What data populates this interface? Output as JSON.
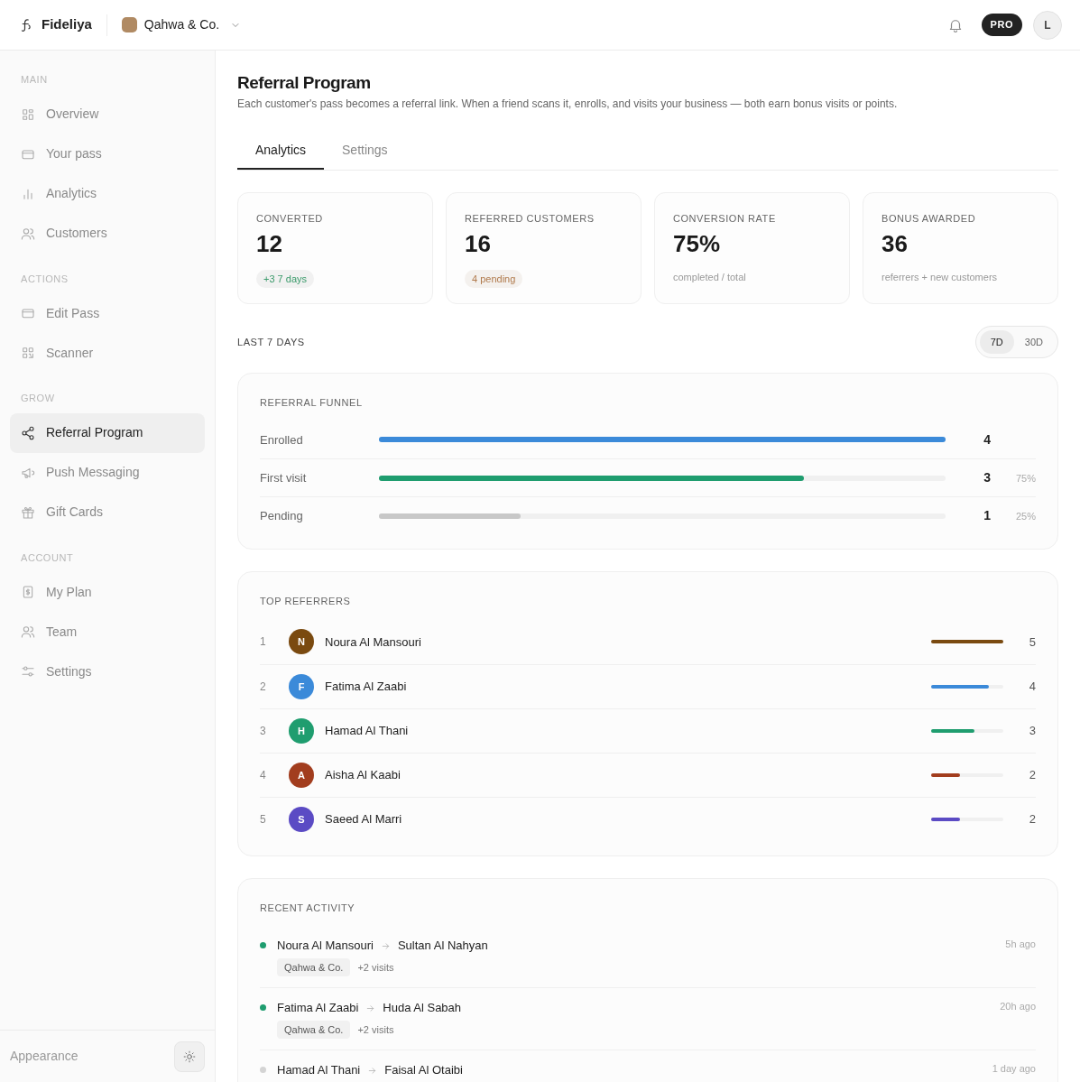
{
  "header": {
    "brand": "Fideliya",
    "business": "Qahwa & Co.",
    "plan_badge": "PRO",
    "avatar_initial": "L"
  },
  "sidebar": {
    "sections": [
      {
        "title": "MAIN",
        "items": [
          {
            "label": "Overview",
            "selected": false
          },
          {
            "label": "Your pass",
            "selected": false
          },
          {
            "label": "Analytics",
            "selected": false
          },
          {
            "label": "Customers",
            "selected": false
          }
        ]
      },
      {
        "title": "ACTIONS",
        "items": [
          {
            "label": "Edit Pass",
            "selected": false
          },
          {
            "label": "Scanner",
            "selected": false
          }
        ]
      },
      {
        "title": "GROW",
        "items": [
          {
            "label": "Referral Program",
            "selected": true
          },
          {
            "label": "Push Messaging",
            "selected": false
          },
          {
            "label": "Gift Cards",
            "selected": false
          }
        ]
      },
      {
        "title": "ACCOUNT",
        "items": [
          {
            "label": "My Plan",
            "selected": false
          },
          {
            "label": "Team",
            "selected": false
          },
          {
            "label": "Settings",
            "selected": false
          }
        ]
      }
    ],
    "footer_label": "Appearance"
  },
  "page": {
    "title": "Referral Program",
    "subtitle": "Each customer's pass becomes a referral link. When a friend scans it, enrolls, and visits your business — both earn bonus visits or points.",
    "tabs": [
      {
        "label": "Analytics",
        "selected": true
      },
      {
        "label": "Settings",
        "selected": false
      }
    ],
    "stats": [
      {
        "label": "CONVERTED",
        "value": "12",
        "note": "+3 7 days",
        "kind": "positive"
      },
      {
        "label": "REFERRED CUSTOMERS",
        "value": "16",
        "note": "4 pending",
        "kind": "warning"
      },
      {
        "label": "CONVERSION RATE",
        "value": "75%",
        "note": "completed / total",
        "kind": "plain"
      },
      {
        "label": "BONUS AWARDED",
        "value": "36",
        "note": "referrers + new customers",
        "kind": "plain"
      }
    ],
    "period_label": "LAST 7 DAYS",
    "periods": [
      {
        "label": "7D",
        "selected": true
      },
      {
        "label": "30D",
        "selected": false
      }
    ],
    "funnel": {
      "title": "REFERRAL FUNNEL",
      "rows": [
        {
          "label": "Enrolled",
          "count": "4",
          "level": 1,
          "color": "#3b8ad9"
        },
        {
          "label": "First visit",
          "count": "3",
          "percent": "75%",
          "level": 0.75,
          "color": "#1f9d6f"
        },
        {
          "label": "Pending",
          "count": "1",
          "percent": "25%",
          "level": 0.25,
          "color": "#c8c8c8"
        }
      ]
    },
    "top_referrers": {
      "title": "TOP REFERRERS",
      "rows": [
        {
          "rank": "1",
          "initial": "N",
          "name": "Noura Al Mansouri",
          "count": "5",
          "level": 1,
          "color": "#7a4a10"
        },
        {
          "rank": "2",
          "initial": "F",
          "name": "Fatima Al Zaabi",
          "count": "4",
          "level": 0.8,
          "color": "#3b8ad9"
        },
        {
          "rank": "3",
          "initial": "H",
          "name": "Hamad Al Thani",
          "count": "3",
          "level": 0.6,
          "color": "#1f9d6f"
        },
        {
          "rank": "4",
          "initial": "A",
          "name": "Aisha Al Kaabi",
          "count": "2",
          "level": 0.4,
          "color": "#a23d1e"
        },
        {
          "rank": "5",
          "initial": "S",
          "name": "Saeed Al Marri",
          "count": "2",
          "level": 0.4,
          "color": "#5b4bc4"
        }
      ]
    },
    "recent_activity": {
      "title": "RECENT ACTIVITY",
      "rows": [
        {
          "referrer": "Noura Al Mansouri",
          "referred": "Sultan Al Nahyan",
          "business": "Qahwa & Co.",
          "reward": "+2 visits",
          "time": "5h ago",
          "color": "#1f9d6f"
        },
        {
          "referrer": "Fatima Al Zaabi",
          "referred": "Huda Al Sabah",
          "business": "Qahwa & Co.",
          "reward": "+2 visits",
          "time": "20h ago",
          "color": "#1f9d6f"
        },
        {
          "referrer": "Hamad Al Thani",
          "referred": "Faisal Al Otaibi",
          "time": "1 day ago",
          "color": "#d4d4d4"
        }
      ]
    }
  }
}
